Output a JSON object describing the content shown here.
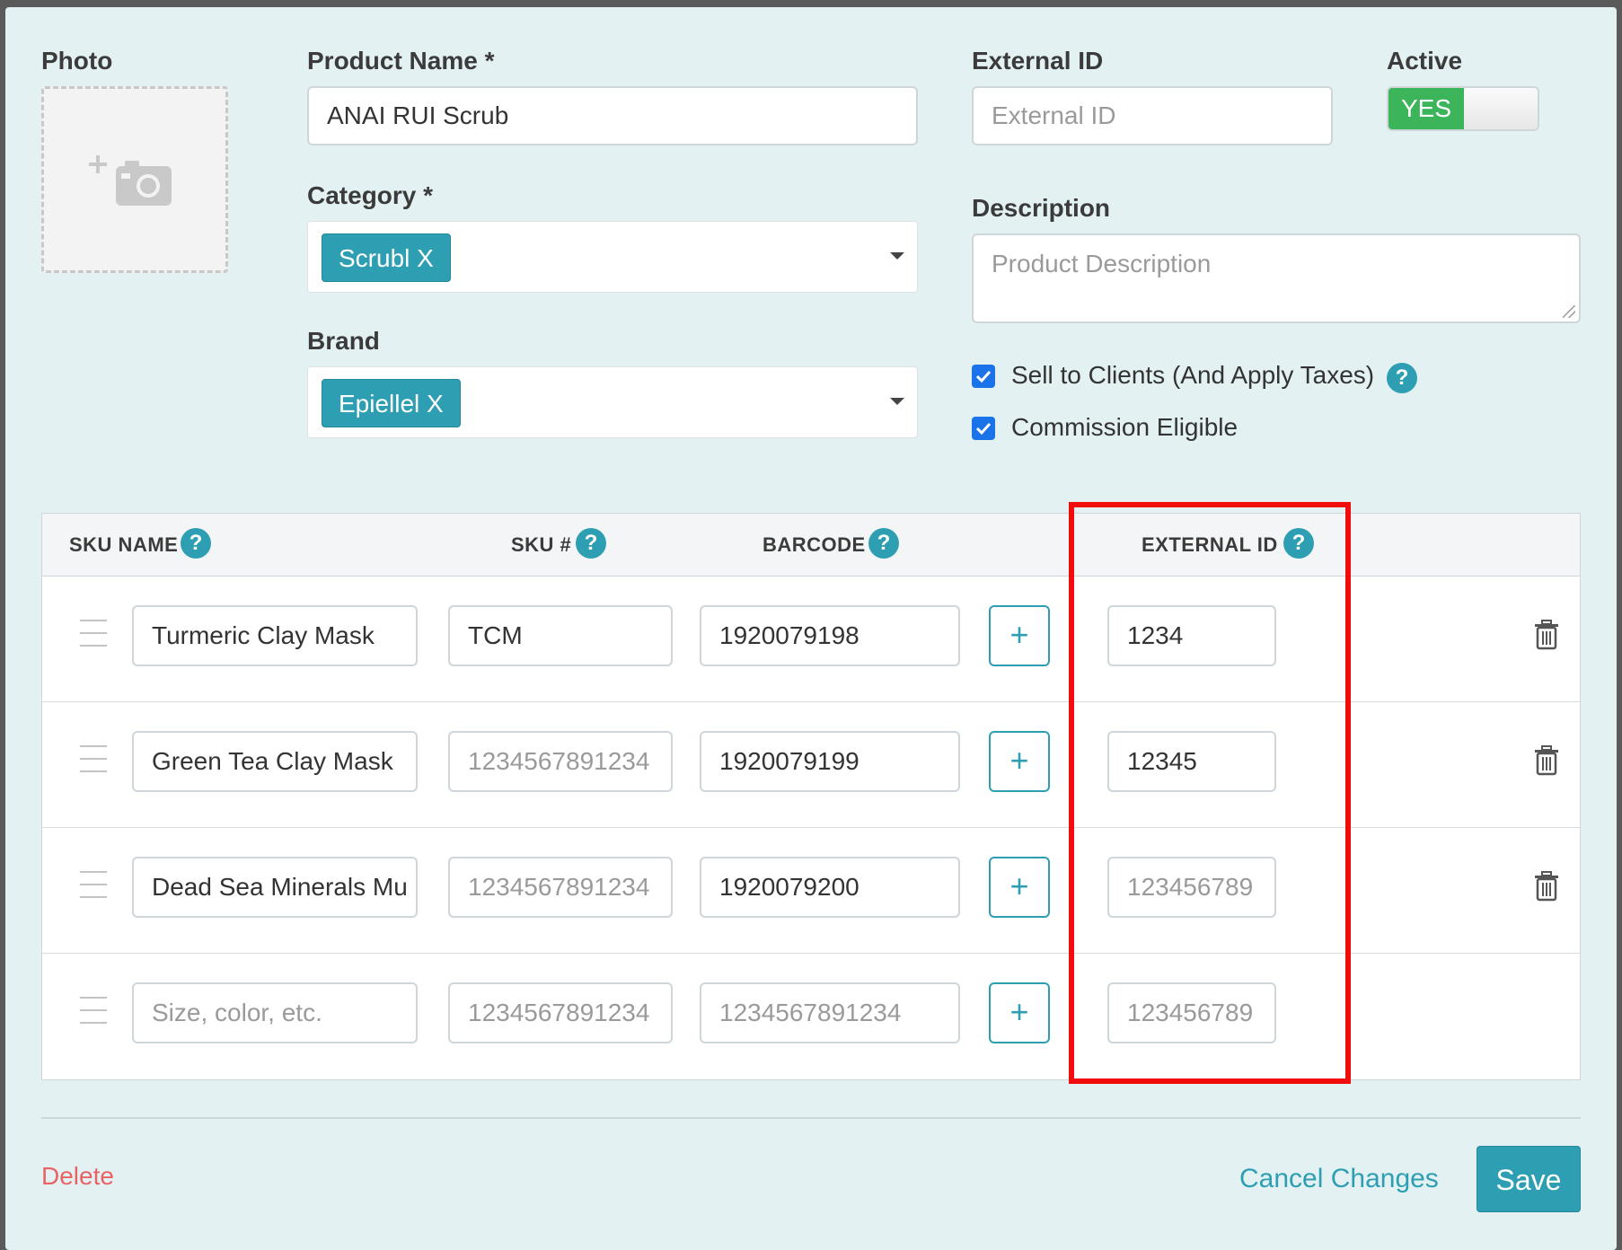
{
  "form": {
    "photo_label": "Photo",
    "product_name_label": "Product Name *",
    "product_name_value": "ANAI RUI Scrub",
    "external_id_label": "External ID",
    "external_id_placeholder": "External ID",
    "active_label": "Active",
    "active_toggle": "YES",
    "category_label": "Category *",
    "category_tag": "Scrubl X",
    "brand_label": "Brand",
    "brand_tag": "Epiellel X",
    "description_label": "Description",
    "description_placeholder": "Product Description",
    "sell_to_clients_label": "Sell to Clients (And Apply Taxes)",
    "commission_label": "Commission Eligible"
  },
  "table": {
    "headers": {
      "sku_name": "SKU NAME",
      "sku_num": "SKU #",
      "barcode": "BARCODE",
      "external_id": "EXTERNAL ID"
    },
    "rows": [
      {
        "name": "Turmeric Clay Mask",
        "sku": "TCM",
        "barcode": "1920079198",
        "external_id": "1234"
      },
      {
        "name": "Green Tea Clay Mask",
        "sku": "1234567891234",
        "barcode": "1920079199",
        "external_id": "12345"
      },
      {
        "name": "Dead Sea Minerals Mu",
        "sku": "1234567891234",
        "barcode": "1920079200",
        "external_id": "123456789"
      },
      {
        "name": "Size, color, etc.",
        "sku": "1234567891234",
        "barcode": "1234567891234",
        "external_id": "123456789"
      }
    ],
    "plus_label": "+",
    "help_glyph": "?"
  },
  "footer": {
    "delete_label": "Delete",
    "cancel_label": "Cancel Changes",
    "save_label": "Save"
  },
  "colors": {
    "accent": "#2e9fb3",
    "toggle_on": "#3cb55a",
    "danger": "#e86464",
    "highlight": "#f20d0d"
  }
}
